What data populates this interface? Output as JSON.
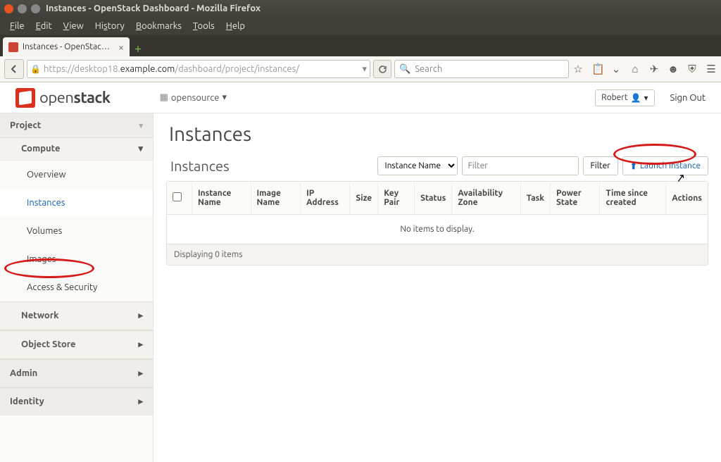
{
  "window": {
    "title": "Instances - OpenStack Dashboard - Mozilla Firefox"
  },
  "browser": {
    "menus": {
      "file": "File",
      "edit": "Edit",
      "view": "View",
      "history": "History",
      "bookmarks": "Bookmarks",
      "tools": "Tools",
      "help": "Help"
    },
    "tab_title": "Instances - OpenStac…",
    "url_prefix": "https://",
    "url_host_dim": "desktop18.",
    "url_host": "example.com",
    "url_path": "/dashboard/project/instances/",
    "search_placeholder": "Search"
  },
  "dashboard": {
    "brand": "openstack",
    "project_picker": "opensource",
    "user": "Robert",
    "signout": "Sign Out"
  },
  "sidebar": {
    "project": "Project",
    "compute": "Compute",
    "overview": "Overview",
    "instances": "Instances",
    "volumes": "Volumes",
    "images": "Images",
    "access": "Access & Security",
    "network": "Network",
    "objectstore": "Object Store",
    "admin": "Admin",
    "identity": "Identity"
  },
  "page": {
    "title": "Instances",
    "panel_title": "Instances",
    "filter_by_label": "Instance Name",
    "filter_placeholder": "Filter",
    "filter_button": "Filter",
    "launch_button": "Launch Instance",
    "columns": {
      "c1": "Instance Name",
      "c2": "Image Name",
      "c3": "IP Address",
      "c4": "Size",
      "c5": "Key Pair",
      "c6": "Status",
      "c7": "Availability Zone",
      "c8": "Task",
      "c9": "Power State",
      "c10": "Time since created",
      "c11": "Actions"
    },
    "empty": "No items to display.",
    "footer": "Displaying 0 items"
  }
}
